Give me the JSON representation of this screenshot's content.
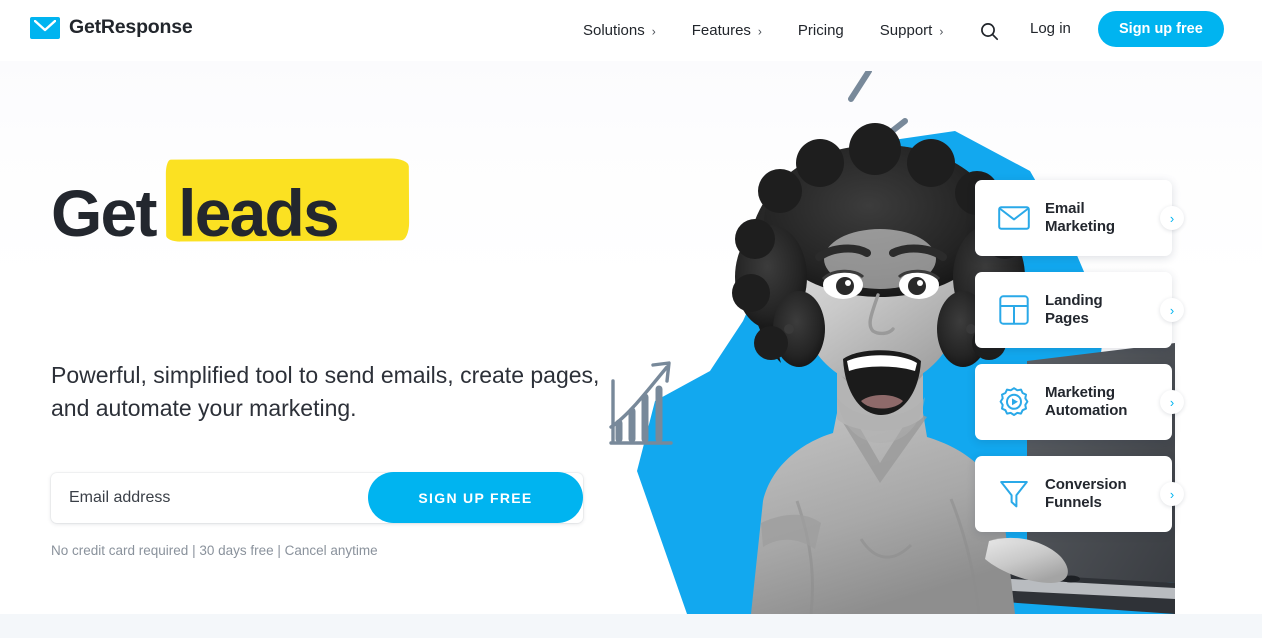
{
  "brand": {
    "name": "GetResponse",
    "logo_icon": "envelope-icon",
    "accent_color": "#00b4f0",
    "highlight_color": "#fbe122",
    "text_color": "#23272e"
  },
  "header": {
    "nav": [
      {
        "label": "Solutions",
        "caret": "›",
        "has_dropdown": true
      },
      {
        "label": "Features",
        "caret": "›",
        "has_dropdown": true
      },
      {
        "label": "Pricing",
        "caret": "",
        "has_dropdown": false
      },
      {
        "label": "Support",
        "caret": "›",
        "has_dropdown": true
      }
    ],
    "search_icon": "search-icon",
    "login_label": "Log in",
    "signup_label": "Sign up free"
  },
  "hero": {
    "headline_plain": "Get",
    "headline_highlight": "leads",
    "subheadline": "Powerful, simplified tool to send emails, create pages, and automate your marketing.",
    "form": {
      "email_placeholder": "Email address",
      "email_value": "",
      "submit_label": "SIGN UP FREE"
    },
    "disclaimer": "No credit card required | 30 days free | Cancel anytime",
    "image_alt": "Smiling woman holding a laptop on a blue cutout background"
  },
  "feature_cards": [
    {
      "label_line1": "Email",
      "label_line2": "Marketing",
      "icon": "envelope-icon",
      "chevron": "›"
    },
    {
      "label_line1": "Landing",
      "label_line2": "Pages",
      "icon": "layout-grid-icon",
      "chevron": "›"
    },
    {
      "label_line1": "Marketing",
      "label_line2": "Automation",
      "icon": "gear-play-icon",
      "chevron": "›"
    },
    {
      "label_line1": "Conversion",
      "label_line2": "Funnels",
      "icon": "funnel-icon",
      "chevron": "›"
    }
  ]
}
